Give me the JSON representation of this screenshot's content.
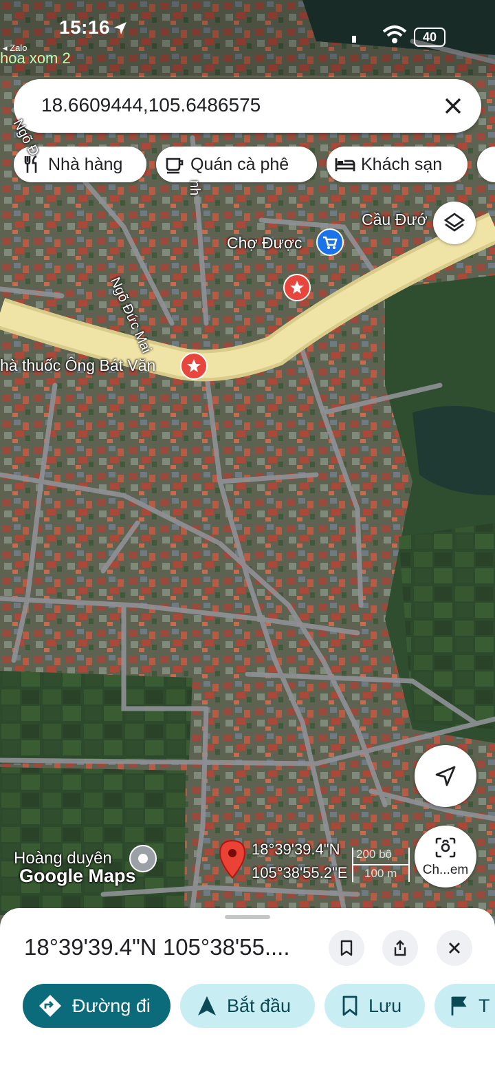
{
  "status_bar": {
    "time": "15:16",
    "back_app": "◂ Zalo",
    "back_subtitle": "hoa xom 2",
    "battery": "40"
  },
  "search": {
    "value": "18.6609444,105.6486575"
  },
  "chips": [
    {
      "label": "Nhà hàng",
      "icon": "fork-knife-icon"
    },
    {
      "label": "Quán cà phê",
      "icon": "coffee-cup-icon"
    },
    {
      "label": "Khách sạn",
      "icon": "bed-icon"
    }
  ],
  "map": {
    "places": {
      "market": "Chợ Được",
      "bridge": "Cầu Đướ",
      "pharmacy": "hà thuốc Ông Bát Văn",
      "street1": "Ngõ Đức Mai",
      "street2": "Ngõ Đ",
      "street3": "nh",
      "user_place": "Hoàng duyên"
    },
    "logo": "Google Maps",
    "pin_coords": {
      "lat": "18°39'39.4\"N",
      "lng": "105°38'55.2\"E"
    },
    "scale": {
      "feet": "200 bộ",
      "meters": "100 m"
    },
    "lens_label": "Ch...em"
  },
  "sheet": {
    "title": "18°39'39.4\"N 105°38'55....",
    "actions": [
      {
        "label": "Đường đi",
        "icon": "directions-icon"
      },
      {
        "label": "Bắt đầu",
        "icon": "navigation-arrow-icon"
      },
      {
        "label": "Lưu",
        "icon": "bookmark-icon"
      },
      {
        "label": "T",
        "icon": "flag-icon"
      }
    ]
  },
  "colors": {
    "accent": "#0b6b7a",
    "chip_light": "#c8eef4",
    "pin": "#ea4335",
    "main_road": "#e8dca0"
  }
}
